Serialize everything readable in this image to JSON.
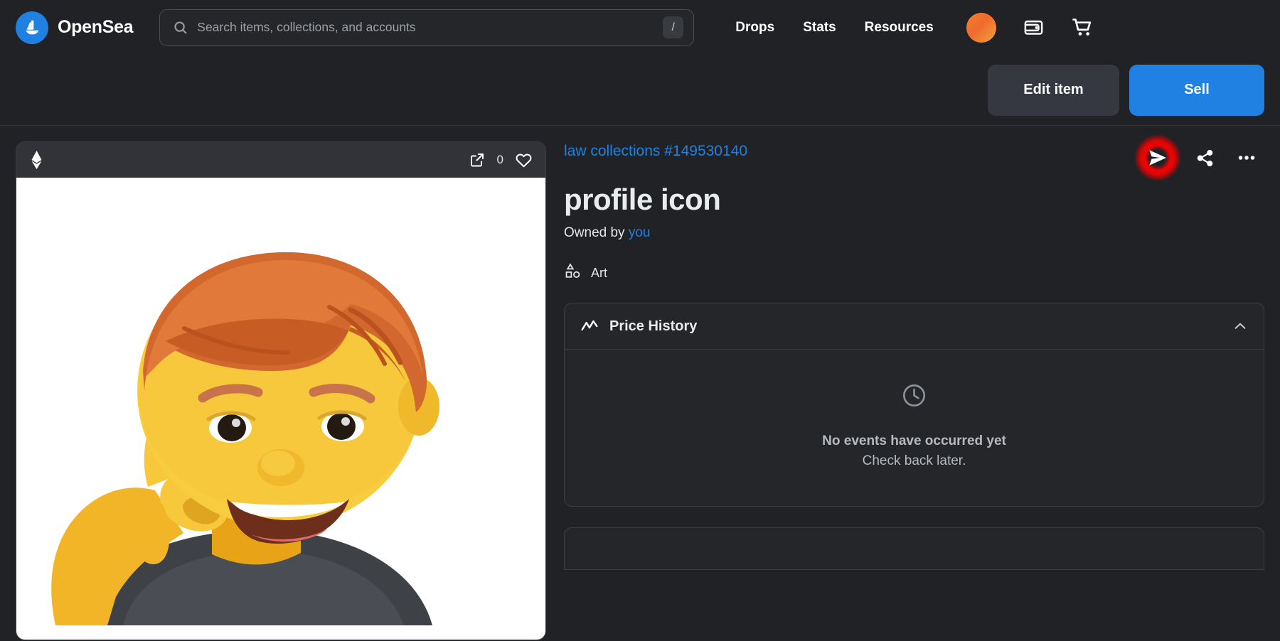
{
  "nav": {
    "brand_name": "OpenSea",
    "brand_logo_icon": "sailboat-icon",
    "search": {
      "placeholder": "Search items, collections, and accounts",
      "value": "",
      "shortcut_badge": "/",
      "icon": "search-icon"
    },
    "links": [
      {
        "label": "Drops"
      },
      {
        "label": "Stats"
      },
      {
        "label": "Resources"
      }
    ],
    "icons": [
      {
        "name": "avatar",
        "kind": "avatar"
      },
      {
        "name": "wallet-icon",
        "kind": "wallet"
      },
      {
        "name": "cart-icon",
        "kind": "cart"
      }
    ]
  },
  "action_bar": {
    "edit_label": "Edit item",
    "sell_label": "Sell"
  },
  "nft_card": {
    "chain_icon": "ethereum-icon",
    "expand_icon": "external-link-icon",
    "like_count": "0",
    "like_icon": "heart-icon",
    "image_alt": "memoji character making a call-me gesture"
  },
  "item": {
    "collection": "law collections #149530140",
    "title": "profile icon",
    "owned_by_prefix": "Owned by",
    "owned_by_value": "you",
    "category": "Art",
    "category_icon": "shapes-icon",
    "actions": [
      {
        "name": "send-icon",
        "highlighted": true
      },
      {
        "name": "share-icon",
        "highlighted": false
      },
      {
        "name": "more-options-icon",
        "highlighted": false
      }
    ]
  },
  "price_history": {
    "title": "Price History",
    "icon": "activity-chart-icon",
    "chevron": "chevron-up-icon",
    "empty_icon": "clock-icon",
    "empty_title": "No events have occurred yet",
    "empty_subtitle": "Check back later."
  },
  "colors": {
    "accent_blue": "#2081E2",
    "background": "#202225",
    "panel": "#24262a",
    "highlight_red": "#ff0000"
  }
}
